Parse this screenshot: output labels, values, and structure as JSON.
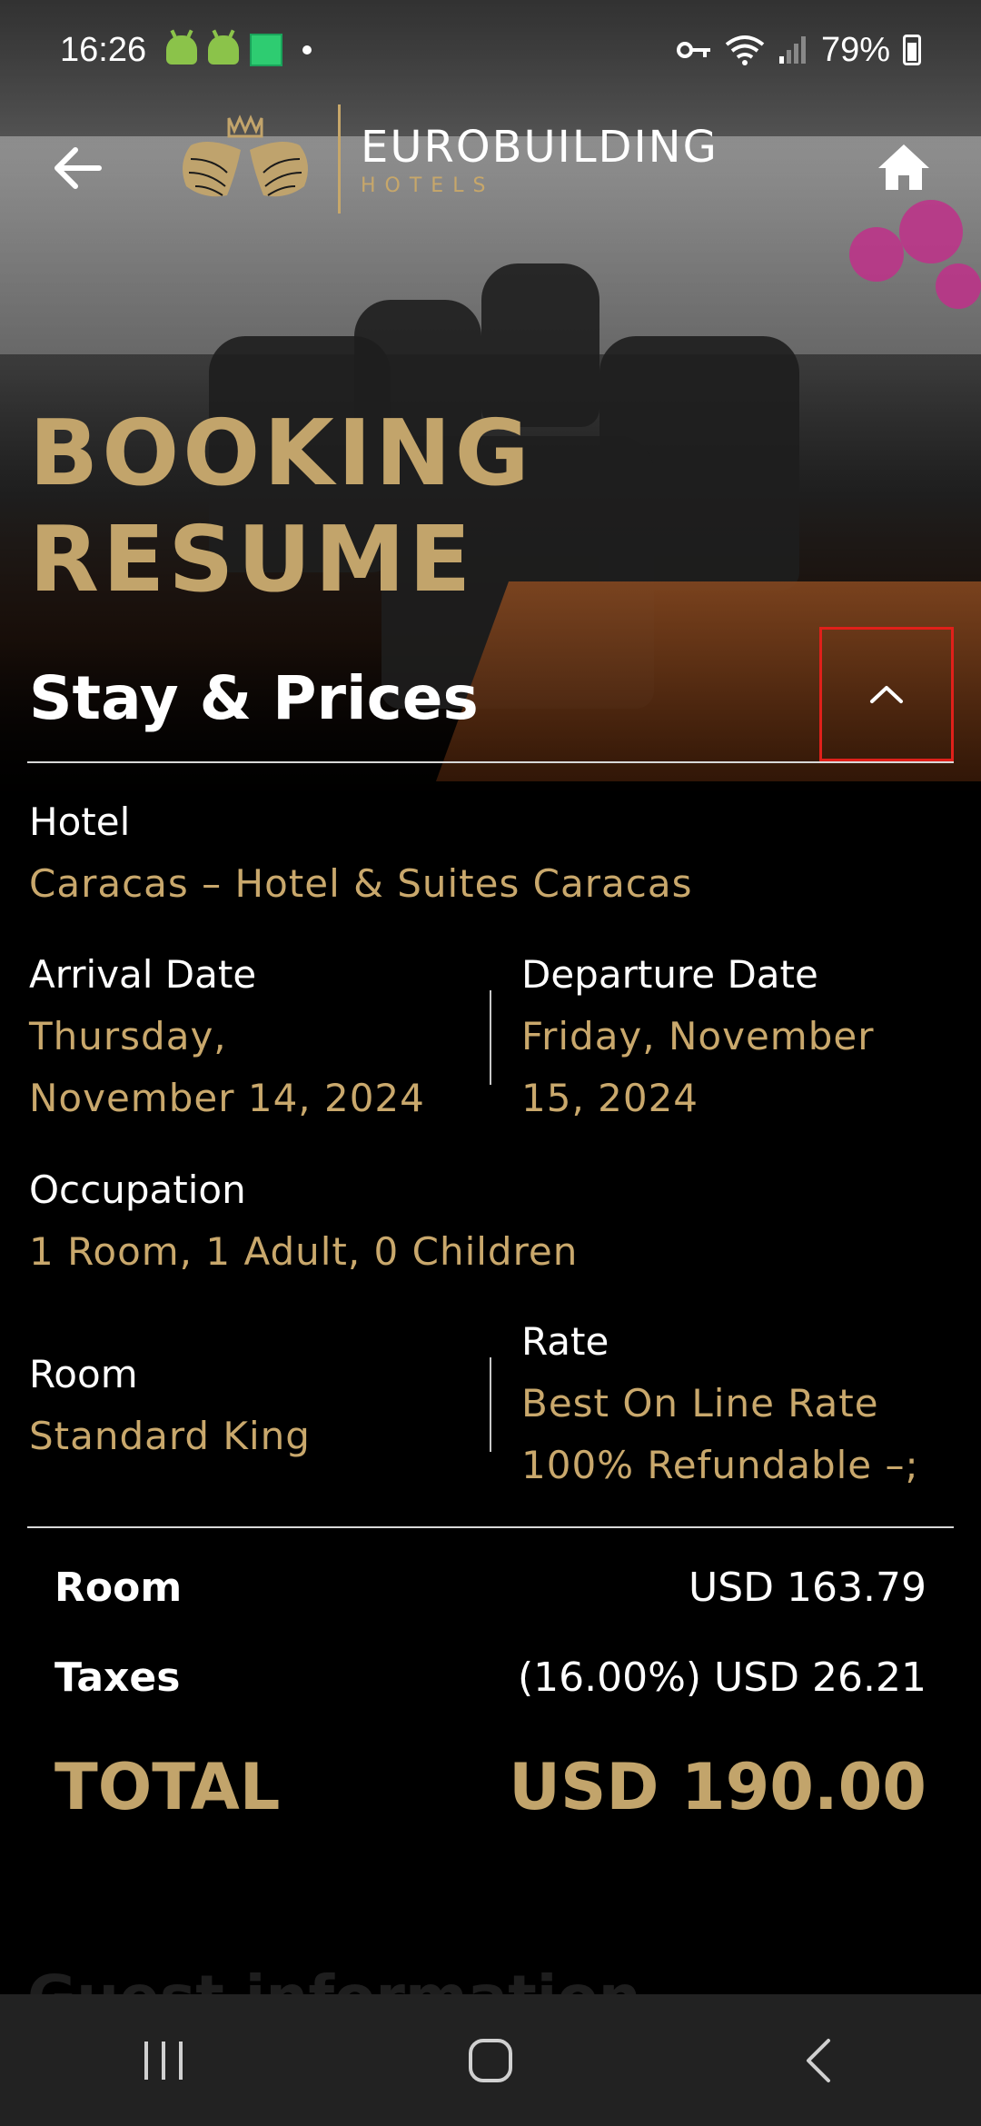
{
  "status_bar": {
    "time": "16:26",
    "battery": "79%",
    "icons_left": [
      "android-icon",
      "android-icon",
      "sheets-icon",
      "dot"
    ],
    "icons_right": [
      "key-icon",
      "wifi-icon",
      "signal-icon",
      "battery-icon"
    ]
  },
  "header": {
    "brand_main": "EUROBUILDING",
    "brand_sub": "HOTELS",
    "back_icon": "arrow-left-icon",
    "home_icon": "home-icon"
  },
  "page": {
    "title": "BOOKING RESUME"
  },
  "section": {
    "title": "Stay & Prices",
    "toggle_icon": "chevron-up-icon"
  },
  "details": {
    "hotel_label": "Hotel",
    "hotel_value": "Caracas – Hotel & Suites Caracas",
    "arrival_label": "Arrival Date",
    "arrival_value_line1": "Thursday,",
    "arrival_value_line2": "November 14, 2024",
    "departure_label": "Departure Date",
    "departure_value_line1": "Friday, November",
    "departure_value_line2": "15, 2024",
    "occupation_label": "Occupation",
    "occupation_value": "1 Room, 1 Adult, 0 Children",
    "room_label": "Room",
    "room_value": "Standard King",
    "rate_label": "Rate",
    "rate_value_line1": "Best On Line Rate",
    "rate_value_line2": "100% Refundable –;"
  },
  "prices": {
    "room_label": "Room",
    "room_value": "USD 163.79",
    "taxes_label": "Taxes",
    "taxes_value": "(16.00%) USD 26.21",
    "total_label": "TOTAL",
    "total_value": "USD 190.00"
  },
  "next_section": {
    "title": "Guest information"
  },
  "colors": {
    "gold": "#c2a46b",
    "highlight": "#e0201a",
    "background": "#000000"
  },
  "nav_bar": {
    "recents_icon": "recents-icon",
    "home_icon": "home-circle-icon",
    "back_icon": "chevron-left-icon"
  }
}
